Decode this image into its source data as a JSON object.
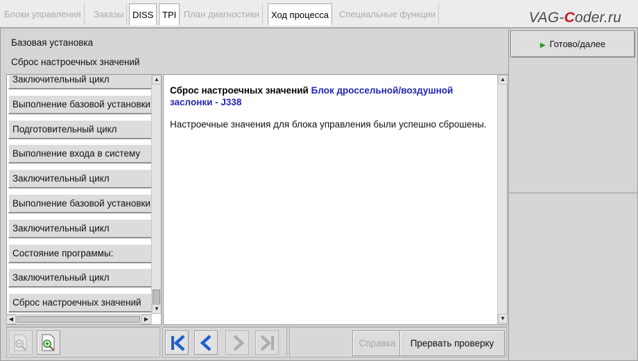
{
  "tabs": [
    {
      "label": "Блоки управления",
      "active": false
    },
    {
      "label": "Заказы",
      "active": false
    },
    {
      "label": "DISS",
      "active": true
    },
    {
      "label": "TPI",
      "active": true
    },
    {
      "label": "План диагностики",
      "active": false
    },
    {
      "label": "Ход процесса",
      "active": true
    },
    {
      "label": "Специальные функции",
      "active": false
    }
  ],
  "logo": {
    "pre": "VAG-",
    "accent": "C",
    "post": "oder.ru"
  },
  "header": {
    "line1": "Базовая установка",
    "line2": "Сброс настроечных значений"
  },
  "steps": [
    "Заключительный цикл",
    "Выполнение базовой установки",
    "Подготовительный цикл",
    "Выполнение входа в систему",
    "Заключительный цикл",
    "Выполнение базовой установки",
    "Заключительный цикл",
    "Состояние программы:",
    "Заключительный цикл",
    "Сброс настроечных значений"
  ],
  "content": {
    "title_prefix": "Сброс настроечных значений",
    "title_highlight": "Блок дроссельной/воздушной заслонки - J338",
    "message": "Настроечные значения для блока управления были успешно сброшены."
  },
  "right_panel": {
    "ready_label": "Готово/далее"
  },
  "bottom": {
    "help_label": "Справка",
    "abort_label": "Прервать проверку"
  },
  "icons": [
    "zoom-out-icon",
    "zoom-in-icon",
    "first-step-icon",
    "prev-step-icon",
    "next-step-icon",
    "last-step-icon",
    "play-icon"
  ],
  "colors": {
    "accent_blue": "#2326b4",
    "nav_blue": "#1f5fd0",
    "play_green": "#1a9a1a",
    "logo_red": "#c8191e"
  }
}
